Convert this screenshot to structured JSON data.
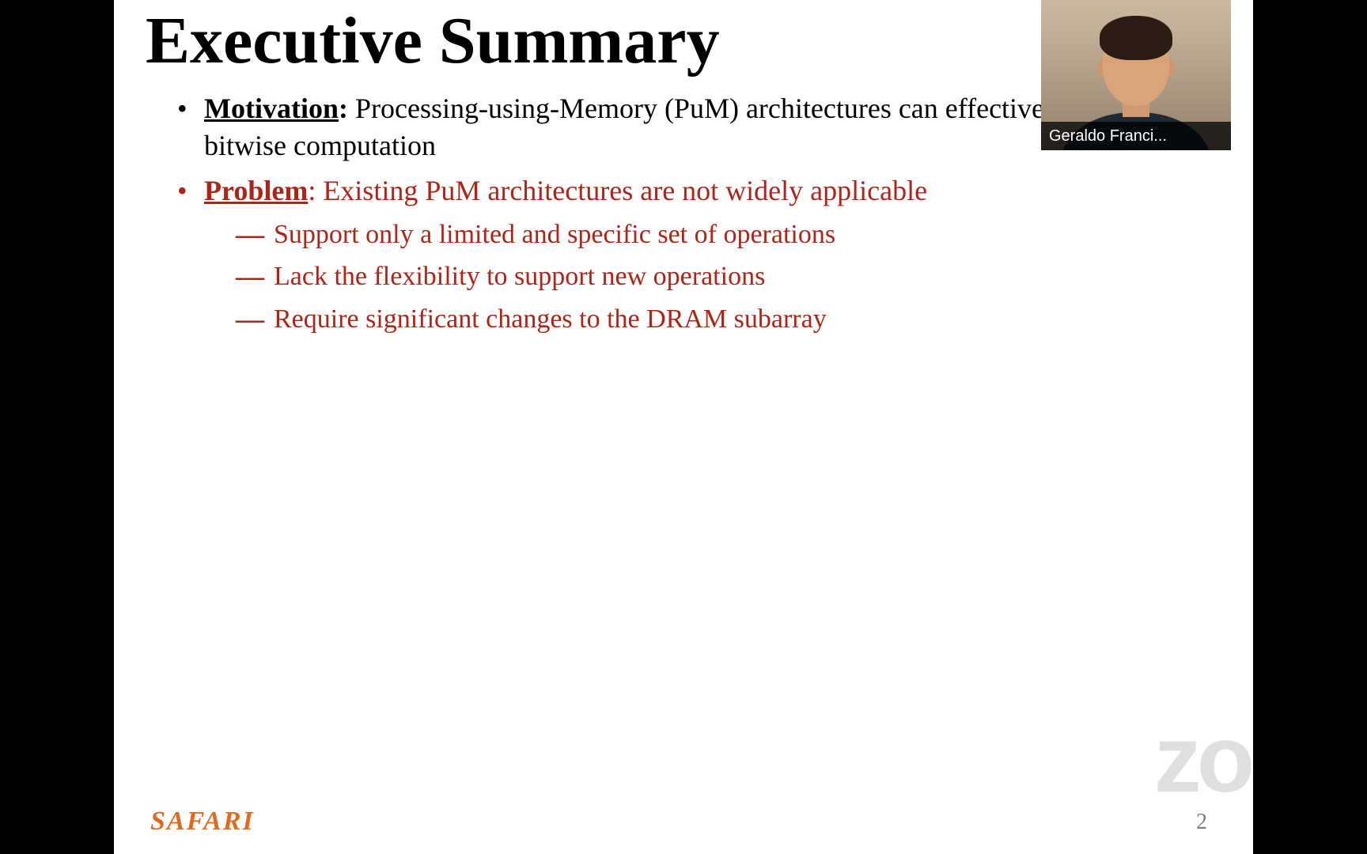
{
  "slide": {
    "title": "Executive Summary",
    "bullets": {
      "motivation_label": "Motivation",
      "motivation_text": " Processing-using-Memory (PuM) architectures can effectively perform bitwise computation",
      "problem_label": "Problem",
      "problem_text": ": Existing PuM architectures are not widely applicable",
      "problem_sub": [
        "Support only a limited and specific set of operations",
        "Lack the flexibility to support new operations",
        "Require significant changes to the DRAM subarray"
      ]
    },
    "footer_logo": "SAFARI",
    "page_number": "2"
  },
  "webcam": {
    "name_label": "Geraldo Franci..."
  },
  "watermark": "zoom"
}
